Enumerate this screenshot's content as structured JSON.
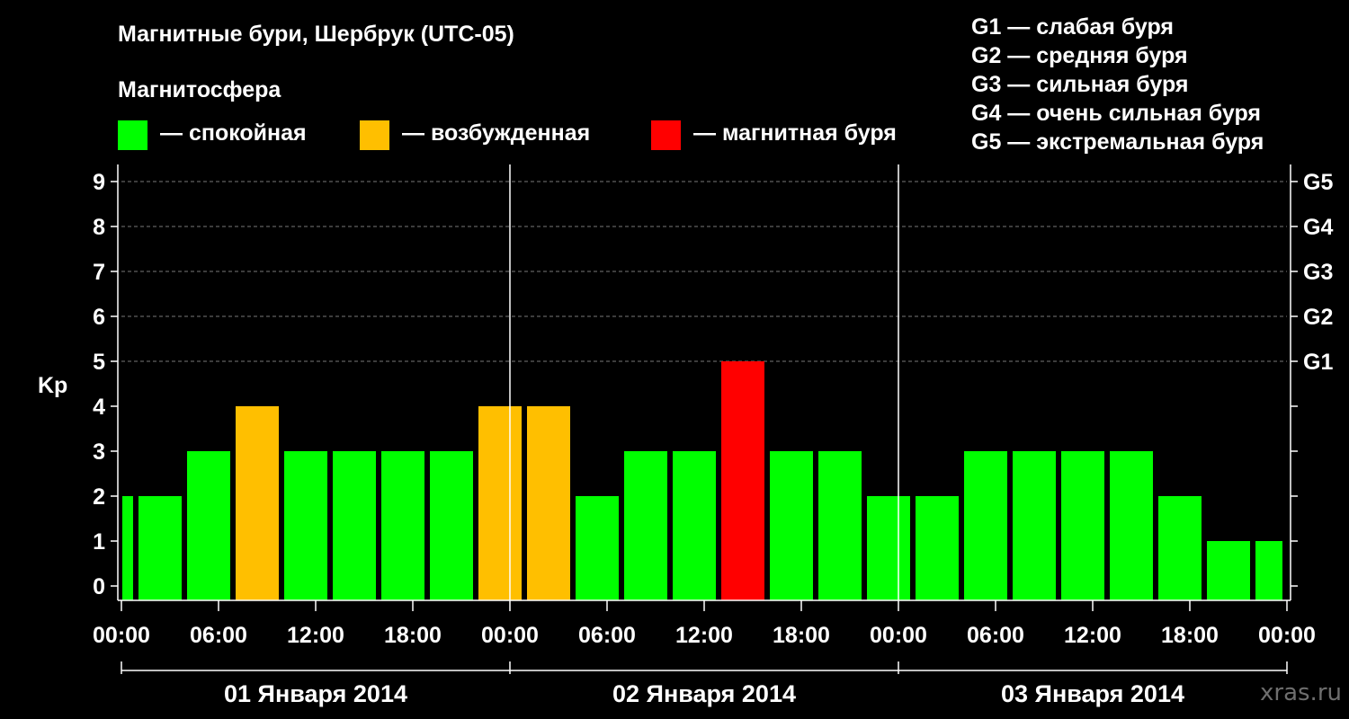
{
  "header": {
    "title": "Магнитные бури, Шербрук (UTC-05)",
    "subtitle": "Магнитосфера"
  },
  "legend": [
    {
      "label": "— спокойная",
      "color": "#00ff00"
    },
    {
      "label": "— возбужденная",
      "color": "#ffbf00"
    },
    {
      "label": "— магнитная буря",
      "color": "#ff0000"
    }
  ],
  "storm_scale": [
    "G1 — слабая буря",
    "G2 — средняя буря",
    "G3 — сильная буря",
    "G4 — очень сильная буря",
    "G5 — экстремальная буря"
  ],
  "watermark": "xras.ru",
  "chart_data": {
    "type": "bar",
    "title": "Магнитные бури, Шербрук (UTC-05)",
    "ylabel": "Kp",
    "ylim": [
      0,
      9
    ],
    "yticks": [
      "0",
      "1",
      "2",
      "3",
      "4",
      "5",
      "6",
      "7",
      "8",
      "9"
    ],
    "right_axis_labels": [
      {
        "kp": 5,
        "label": "G1"
      },
      {
        "kp": 6,
        "label": "G2"
      },
      {
        "kp": 7,
        "label": "G3"
      },
      {
        "kp": 8,
        "label": "G4"
      },
      {
        "kp": 9,
        "label": "G5"
      }
    ],
    "xticks": [
      "00:00",
      "06:00",
      "12:00",
      "18:00",
      "00:00",
      "06:00",
      "12:00",
      "18:00",
      "00:00",
      "06:00",
      "12:00",
      "18:00",
      "00:00"
    ],
    "days": [
      "01 Января 2014",
      "02 Января 2014",
      "03 Января 2014"
    ],
    "x_range_hours": [
      0,
      72
    ],
    "grid": "dashed horizontal at Kp 5–9",
    "bars": [
      {
        "start_hour": 0,
        "end_hour": 1,
        "kp": 2,
        "level": "quiet"
      },
      {
        "start_hour": 1,
        "end_hour": 4,
        "kp": 2,
        "level": "quiet"
      },
      {
        "start_hour": 4,
        "end_hour": 7,
        "kp": 3,
        "level": "quiet"
      },
      {
        "start_hour": 7,
        "end_hour": 10,
        "kp": 4,
        "level": "active"
      },
      {
        "start_hour": 10,
        "end_hour": 13,
        "kp": 3,
        "level": "quiet"
      },
      {
        "start_hour": 13,
        "end_hour": 16,
        "kp": 3,
        "level": "quiet"
      },
      {
        "start_hour": 16,
        "end_hour": 19,
        "kp": 3,
        "level": "quiet"
      },
      {
        "start_hour": 19,
        "end_hour": 22,
        "kp": 3,
        "level": "quiet"
      },
      {
        "start_hour": 22,
        "end_hour": 25,
        "kp": 4,
        "level": "active"
      },
      {
        "start_hour": 25,
        "end_hour": 28,
        "kp": 4,
        "level": "active"
      },
      {
        "start_hour": 28,
        "end_hour": 31,
        "kp": 2,
        "level": "quiet"
      },
      {
        "start_hour": 31,
        "end_hour": 34,
        "kp": 3,
        "level": "quiet"
      },
      {
        "start_hour": 34,
        "end_hour": 37,
        "kp": 3,
        "level": "quiet"
      },
      {
        "start_hour": 37,
        "end_hour": 40,
        "kp": 5,
        "level": "storm"
      },
      {
        "start_hour": 40,
        "end_hour": 43,
        "kp": 3,
        "level": "quiet"
      },
      {
        "start_hour": 43,
        "end_hour": 46,
        "kp": 3,
        "level": "quiet"
      },
      {
        "start_hour": 46,
        "end_hour": 49,
        "kp": 2,
        "level": "quiet"
      },
      {
        "start_hour": 49,
        "end_hour": 52,
        "kp": 2,
        "level": "quiet"
      },
      {
        "start_hour": 52,
        "end_hour": 55,
        "kp": 3,
        "level": "quiet"
      },
      {
        "start_hour": 55,
        "end_hour": 58,
        "kp": 3,
        "level": "quiet"
      },
      {
        "start_hour": 58,
        "end_hour": 61,
        "kp": 3,
        "level": "quiet"
      },
      {
        "start_hour": 61,
        "end_hour": 64,
        "kp": 3,
        "level": "quiet"
      },
      {
        "start_hour": 64,
        "end_hour": 67,
        "kp": 2,
        "level": "quiet"
      },
      {
        "start_hour": 67,
        "end_hour": 70,
        "kp": 1,
        "level": "quiet"
      },
      {
        "start_hour": 70,
        "end_hour": 72,
        "kp": 1,
        "level": "quiet"
      }
    ],
    "colors": {
      "quiet": "#00ff00",
      "active": "#ffbf00",
      "storm": "#ff0000"
    }
  }
}
